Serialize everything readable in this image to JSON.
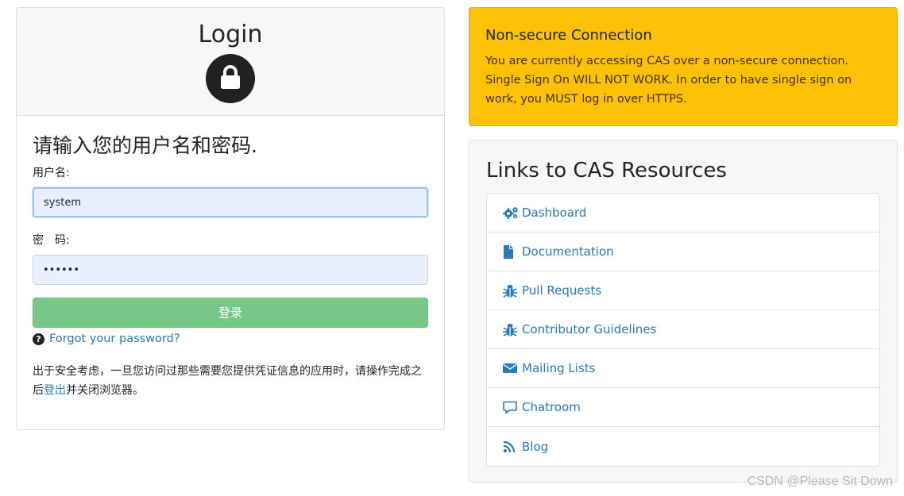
{
  "login": {
    "title": "Login",
    "prompt": "请输入您的用户名和密码.",
    "username_label": "用户名:",
    "username_value": "system",
    "password_label": "密　码:",
    "password_value": "••••••",
    "submit_label": "登录",
    "forgot_label": "Forgot your password?",
    "security_note_before": "出于安全考虑，一旦您访问过那些需要您提供凭证信息的应用时，请操作完成之后",
    "security_note_link": "登出",
    "security_note_after": "并关闭浏览器。"
  },
  "warning": {
    "title": "Non-secure Connection",
    "text": "You are currently accessing CAS over a non-secure connection. Single Sign On WILL NOT WORK. In order to have single sign on work, you MUST log in over HTTPS."
  },
  "resources": {
    "title": "Links to CAS Resources",
    "items": [
      {
        "label": "Dashboard",
        "icon": "cogs-icon"
      },
      {
        "label": "Documentation",
        "icon": "file-icon"
      },
      {
        "label": "Pull Requests",
        "icon": "bug-icon"
      },
      {
        "label": "Contributor Guidelines",
        "icon": "bug-icon"
      },
      {
        "label": "Mailing Lists",
        "icon": "envelope-icon"
      },
      {
        "label": "Chatroom",
        "icon": "comment-icon"
      },
      {
        "label": "Blog",
        "icon": "rss-icon"
      }
    ]
  },
  "watermark": "CSDN @Please Sit Down",
  "colors": {
    "warning_bg": "#fdc107",
    "login_button": "#76c788",
    "link": "#2b79b7"
  }
}
